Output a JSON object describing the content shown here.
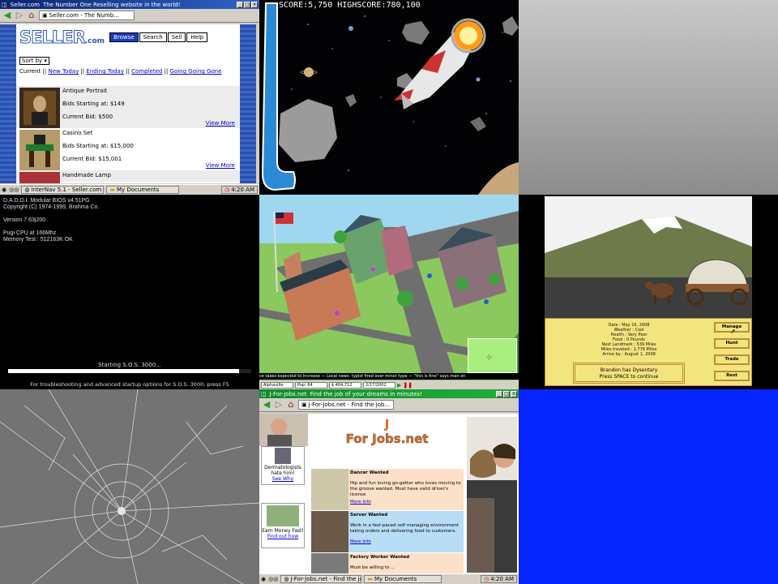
{
  "browser": {
    "title": "Seller.com",
    "subtitle": "The Number One Reselling website in the world!",
    "tab": "Seller.com - The Numb...",
    "logo": "SELLER",
    "logo_suffix": ".com",
    "nav": [
      "Browse",
      "Search",
      "Sell",
      "Help"
    ],
    "sort_label": "Sort by",
    "filters": {
      "current": "Current",
      "links": [
        "New Today",
        "Ending Today",
        "Completed",
        "Going Going Gone"
      ]
    },
    "listings": [
      {
        "name": "Antique Portrait",
        "bids_start": "Bids Starting at: $149",
        "current_bid": "Current Bid: $500",
        "more": "View More"
      },
      {
        "name": "Casino Set",
        "bids_start": "Bids Starting at: $15,000",
        "current_bid": "Current Bid: $15,001",
        "more": "View More"
      },
      {
        "name": "Handmade Lamp"
      }
    ],
    "taskbar": {
      "app": "InterNav 5.1 - Seller.com",
      "folder": "My Documents",
      "clock": "4:20 AM"
    }
  },
  "space_game": {
    "score_label": "SCORE:",
    "score": "5,750",
    "highscore_label": "HIGHSCORE:",
    "highscore": "780,100"
  },
  "bios": {
    "lines": [
      "D.A.D.D.I. Modular BIOS v4.51PG",
      "Copyright (C) 1974-1999, Brahma Co.",
      "",
      "Version 7.63j200",
      "",
      "Pugi CPU at 166Mhz",
      "Memory Test : 512163K OK"
    ],
    "status": "Starting S.O.S. 3000...",
    "progress": 0.95,
    "hint": "For troubleshooting and advanced startup options for S.O.S. 3000, press F5"
  },
  "city_game": {
    "ticker": "ce taxes expected to increase — Local news: typist fired over minor type — \"this is fine\" says man on",
    "town": "Alphaville",
    "pop": "Pop: 64",
    "funds": "$ 404,712",
    "date": "2/17/2002"
  },
  "trail_game": {
    "stats": [
      "Date : May 16, 2008",
      "Weather : Cool",
      "Health : Very Poor",
      "Food : 0 Pounds",
      "Next Landmark : 539 Miles",
      "Miles traveled : 1,776 Miles",
      "Arrive by : August 1, 2008"
    ],
    "message": [
      "Brandon has Dysentary",
      "Press SPACE to continue"
    ],
    "buttons": [
      "Manage",
      "Hunt",
      "Trade",
      "Rest"
    ]
  },
  "jobs": {
    "title": "J-For-Jobs.net",
    "subtitle": "Find the job of your dreams in minutes!",
    "tab": "J-For-Jobs.net - Find the job...",
    "logo_letter": "J",
    "logo": "For Jobs.net",
    "ads": [
      {
        "text": "Dermatologists hate him!",
        "link": "See Why"
      },
      {
        "text": "Earn Money Fast!",
        "link": "Find out how"
      }
    ],
    "listings": [
      {
        "title": "Dancer Wanted",
        "desc": "Hip and fun loving go-getter who loves moving to the groove wanted. Must have valid driver's license",
        "more": "More Info"
      },
      {
        "title": "Server Wanted",
        "desc": "Work in a fast-paced self managing environment taking orders and delivering food to customers.",
        "more": "More Info"
      },
      {
        "title": "Factory Worker Wanted",
        "desc": "Must be willing to ..."
      }
    ],
    "taskbar": {
      "app": "J-For-Jobs.net - Find the job...",
      "folder": "My Documents",
      "clock": "4:20 AM"
    }
  }
}
